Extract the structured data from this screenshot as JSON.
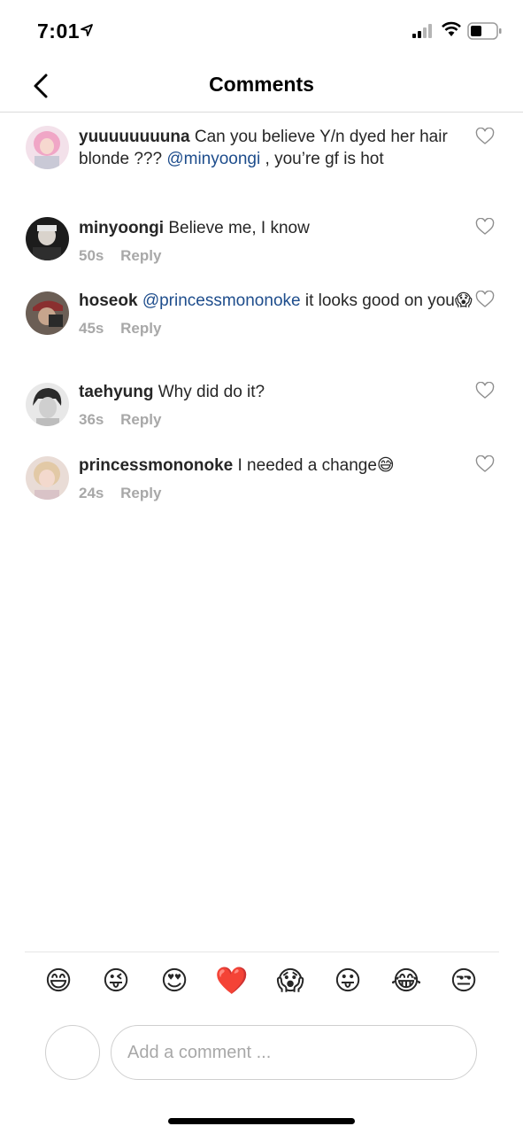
{
  "status_bar": {
    "time": "7:01"
  },
  "header": {
    "title": "Comments"
  },
  "caption": {
    "user": "yuuuuuuuuna",
    "text_before": "Can you believe Y/n dyed her hair blonde ??? ",
    "mention": "@minyoongi",
    "text_after": " , you’re gf is hot"
  },
  "comments": [
    {
      "user": "minyoongi",
      "text": "Believe me, I know",
      "time": "50s",
      "reply": "Reply"
    },
    {
      "user": "hoseok",
      "mention": "@princessmononoke",
      "text": " it looks good on you😱",
      "time": "45s",
      "reply": "Reply"
    },
    {
      "user": "taehyung",
      "text": "Why did do it?",
      "time": "36s",
      "reply": "Reply"
    },
    {
      "user": "princessmononoke",
      "text": "I needed a change😅",
      "time": "24s",
      "reply": "Reply"
    }
  ],
  "emoji_bar": [
    "😄",
    "😜",
    "😍",
    "❤️",
    "😱",
    "😛",
    "😂",
    "😒"
  ],
  "composer": {
    "placeholder": "Add a comment ..."
  },
  "colors": {
    "mention": "#1e4d8c",
    "meta": "#a8a8a8",
    "divider": "#dbdbdb"
  }
}
